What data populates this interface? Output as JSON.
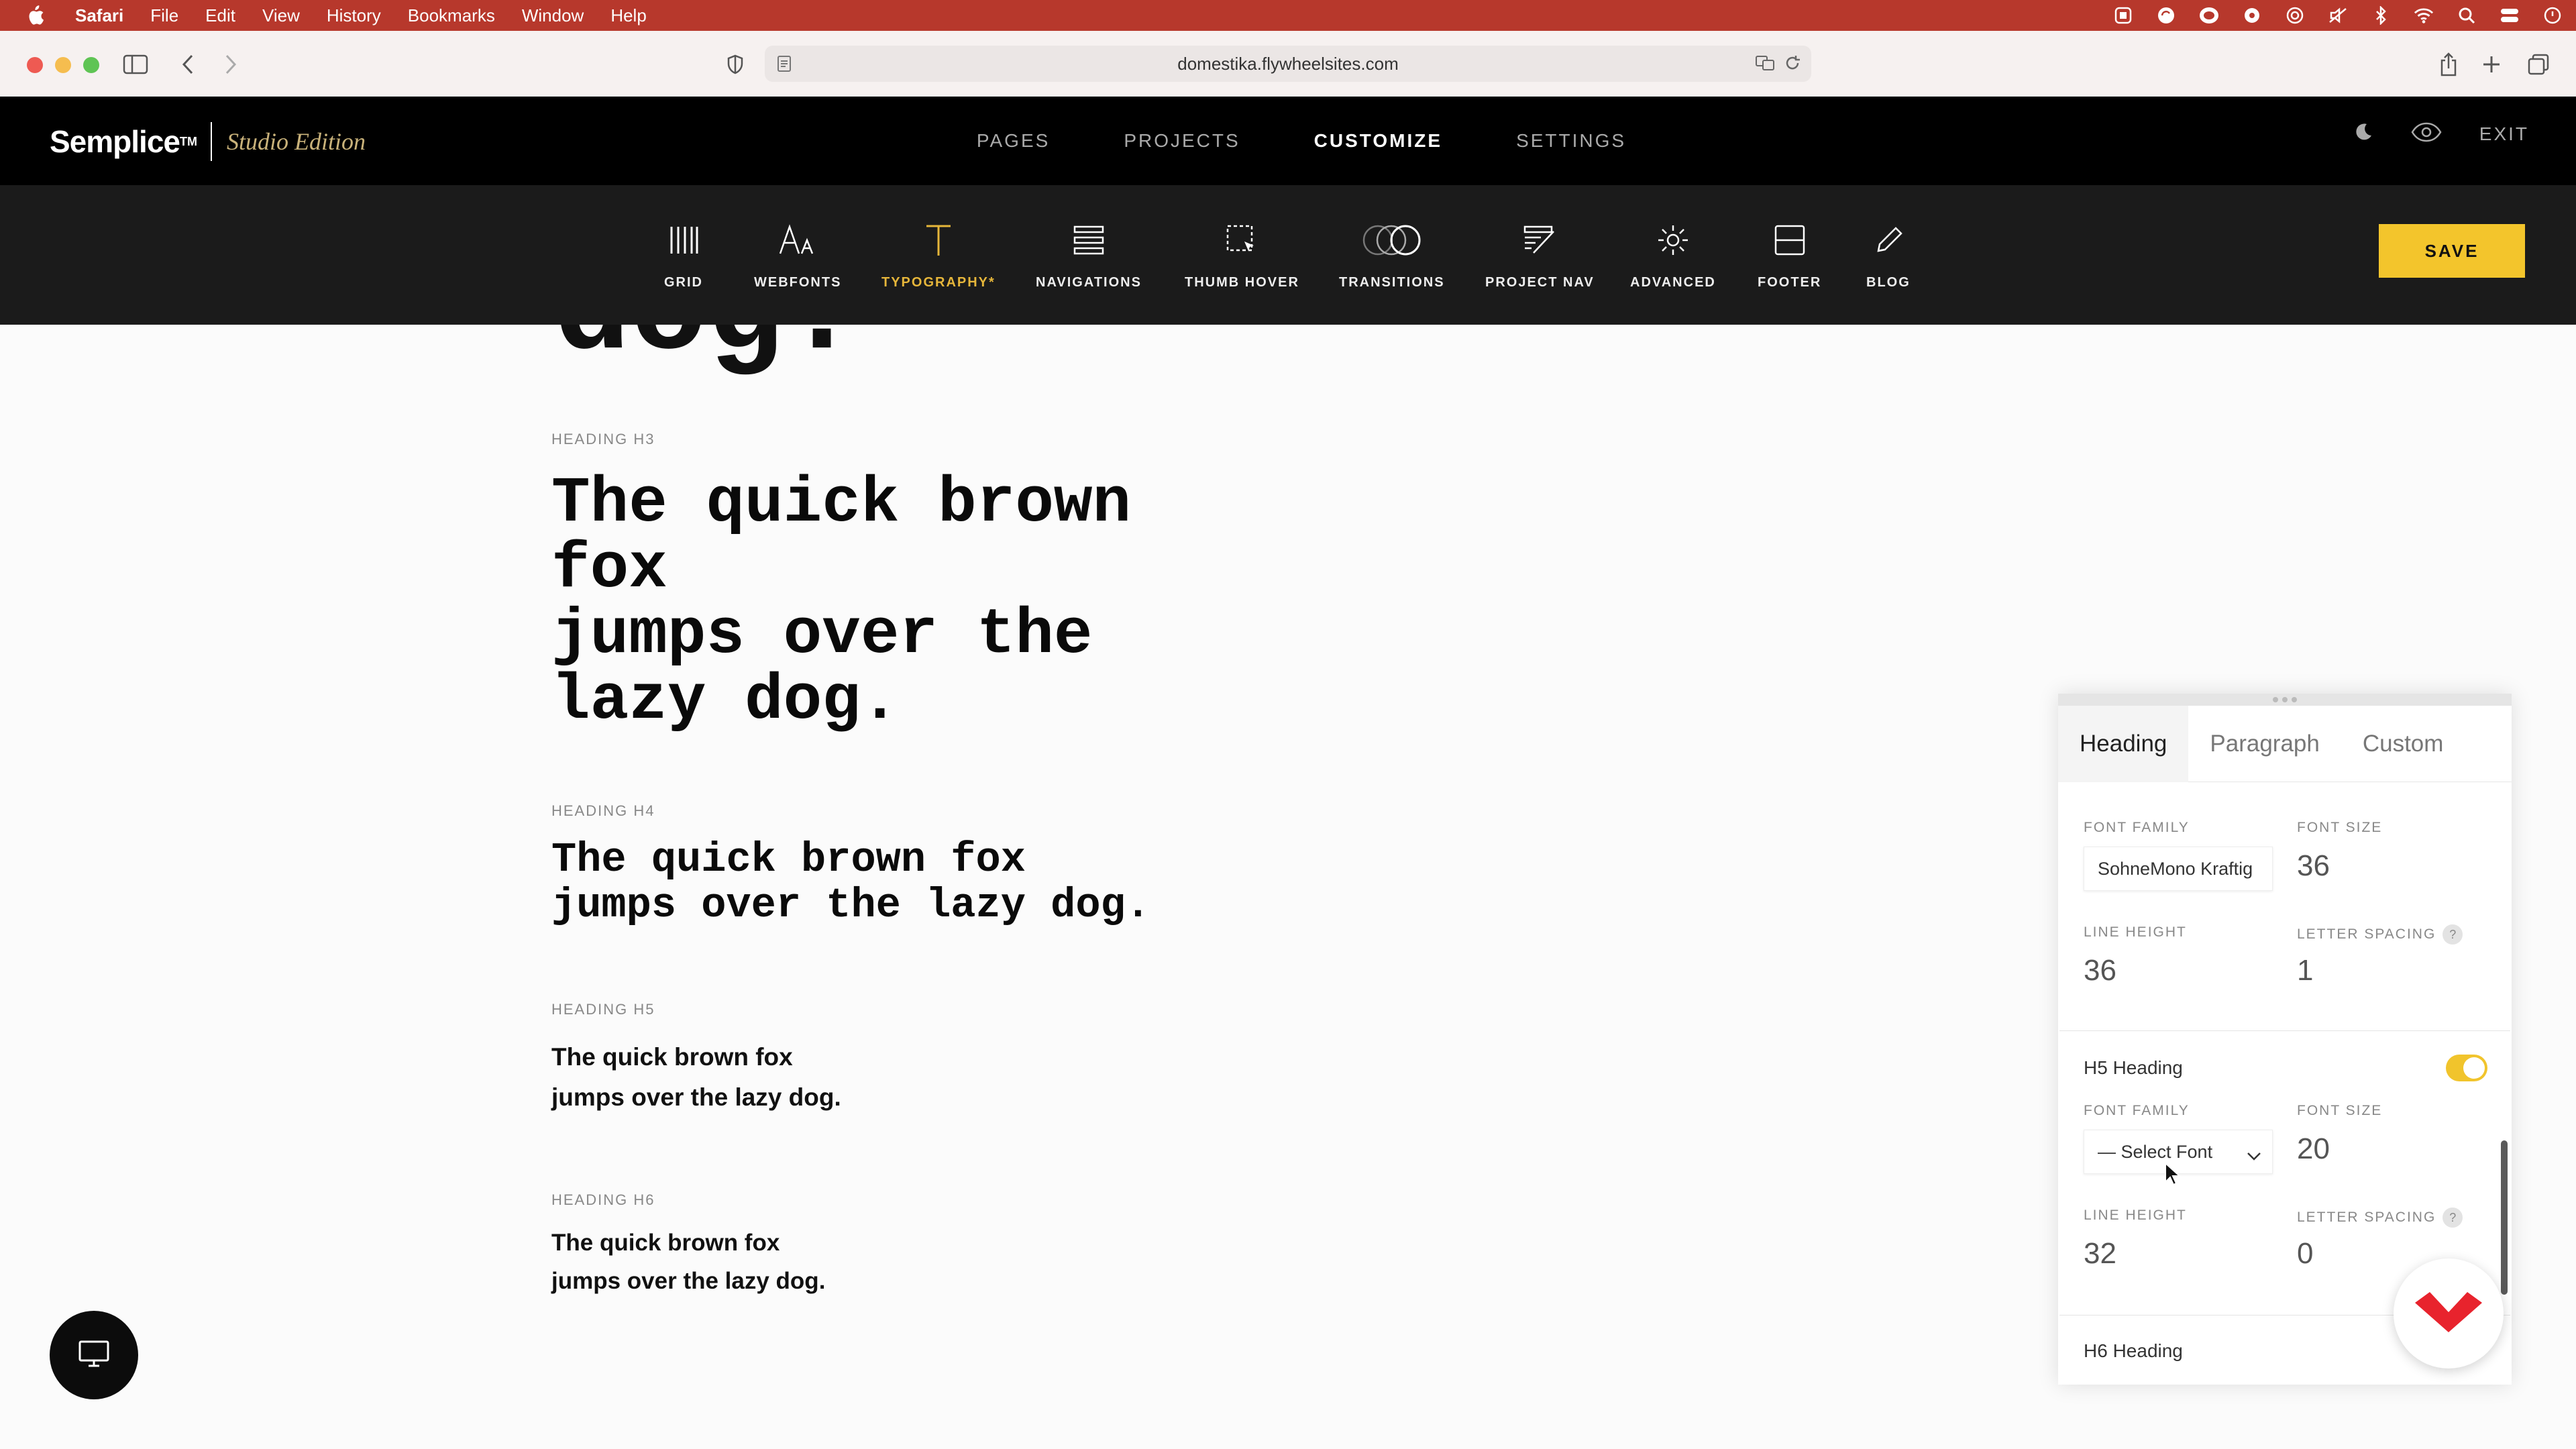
{
  "menubar": {
    "app": "Safari",
    "items": [
      "File",
      "Edit",
      "View",
      "History",
      "Bookmarks",
      "Window",
      "Help"
    ]
  },
  "browser": {
    "url": "domestika.flywheelsites.com"
  },
  "header": {
    "brand": "Semplice",
    "trademark": "TM",
    "edition": "Studio Edition",
    "nav": [
      "PAGES",
      "PROJECTS",
      "CUSTOMIZE",
      "SETTINGS"
    ],
    "active_nav": "CUSTOMIZE",
    "exit_label": "EXIT"
  },
  "toolbar": {
    "tools": [
      {
        "label": "GRID",
        "icon": "grid-icon"
      },
      {
        "label": "WEBFONTS",
        "icon": "webfonts-icon"
      },
      {
        "label": "TYPOGRAPHY*",
        "icon": "typography-icon"
      },
      {
        "label": "NAVIGATIONS",
        "icon": "navigations-icon"
      },
      {
        "label": "THUMB HOVER",
        "icon": "thumb-hover-icon"
      },
      {
        "label": "TRANSITIONS",
        "icon": "transitions-icon"
      },
      {
        "label": "PROJECT NAV",
        "icon": "project-nav-icon"
      },
      {
        "label": "ADVANCED",
        "icon": "advanced-icon"
      },
      {
        "label": "FOOTER",
        "icon": "footer-icon"
      },
      {
        "label": "BLOG",
        "icon": "blog-icon"
      }
    ],
    "active_tool": "TYPOGRAPHY*",
    "save_label": "SAVE"
  },
  "preview": {
    "cutoff_text": "dog.",
    "h3": {
      "label": "HEADING H3",
      "text": "The quick brown\nfox\njumps over the\nlazy dog."
    },
    "h4": {
      "label": "HEADING H4",
      "text": "The quick brown fox\njumps over the lazy dog."
    },
    "h5": {
      "label": "HEADING H5",
      "text": "The quick brown fox\njumps over the lazy dog."
    },
    "h6": {
      "label": "HEADING H6",
      "text": "The quick brown fox\njumps over the lazy dog."
    }
  },
  "panel": {
    "tabs": [
      "Heading",
      "Paragraph",
      "Custom"
    ],
    "active_tab": "Heading",
    "h4_settings": {
      "font_family_label": "FONT FAMILY",
      "font_family_value": "SohneMono Kraftig",
      "font_size_label": "FONT SIZE",
      "font_size_value": "36",
      "line_height_label": "LINE HEIGHT",
      "line_height_value": "36",
      "letter_spacing_label": "LETTER SPACING",
      "letter_spacing_value": "1"
    },
    "h5_section": {
      "title": "H5 Heading",
      "enabled": true,
      "font_family_label": "FONT FAMILY",
      "font_family_value": "— Select Font",
      "font_size_label": "FONT SIZE",
      "font_size_value": "20",
      "line_height_label": "LINE HEIGHT",
      "line_height_value": "32",
      "letter_spacing_label": "LETTER SPACING",
      "letter_spacing_value": "0"
    },
    "h6_section": {
      "title": "H6 Heading"
    },
    "help_glyph": "?"
  },
  "colors": {
    "menubar": "#b7382c",
    "accent": "#f3c52c",
    "active_tool": "#e6b63a",
    "edition": "#c9b27a",
    "domestika": "#e8232d"
  }
}
